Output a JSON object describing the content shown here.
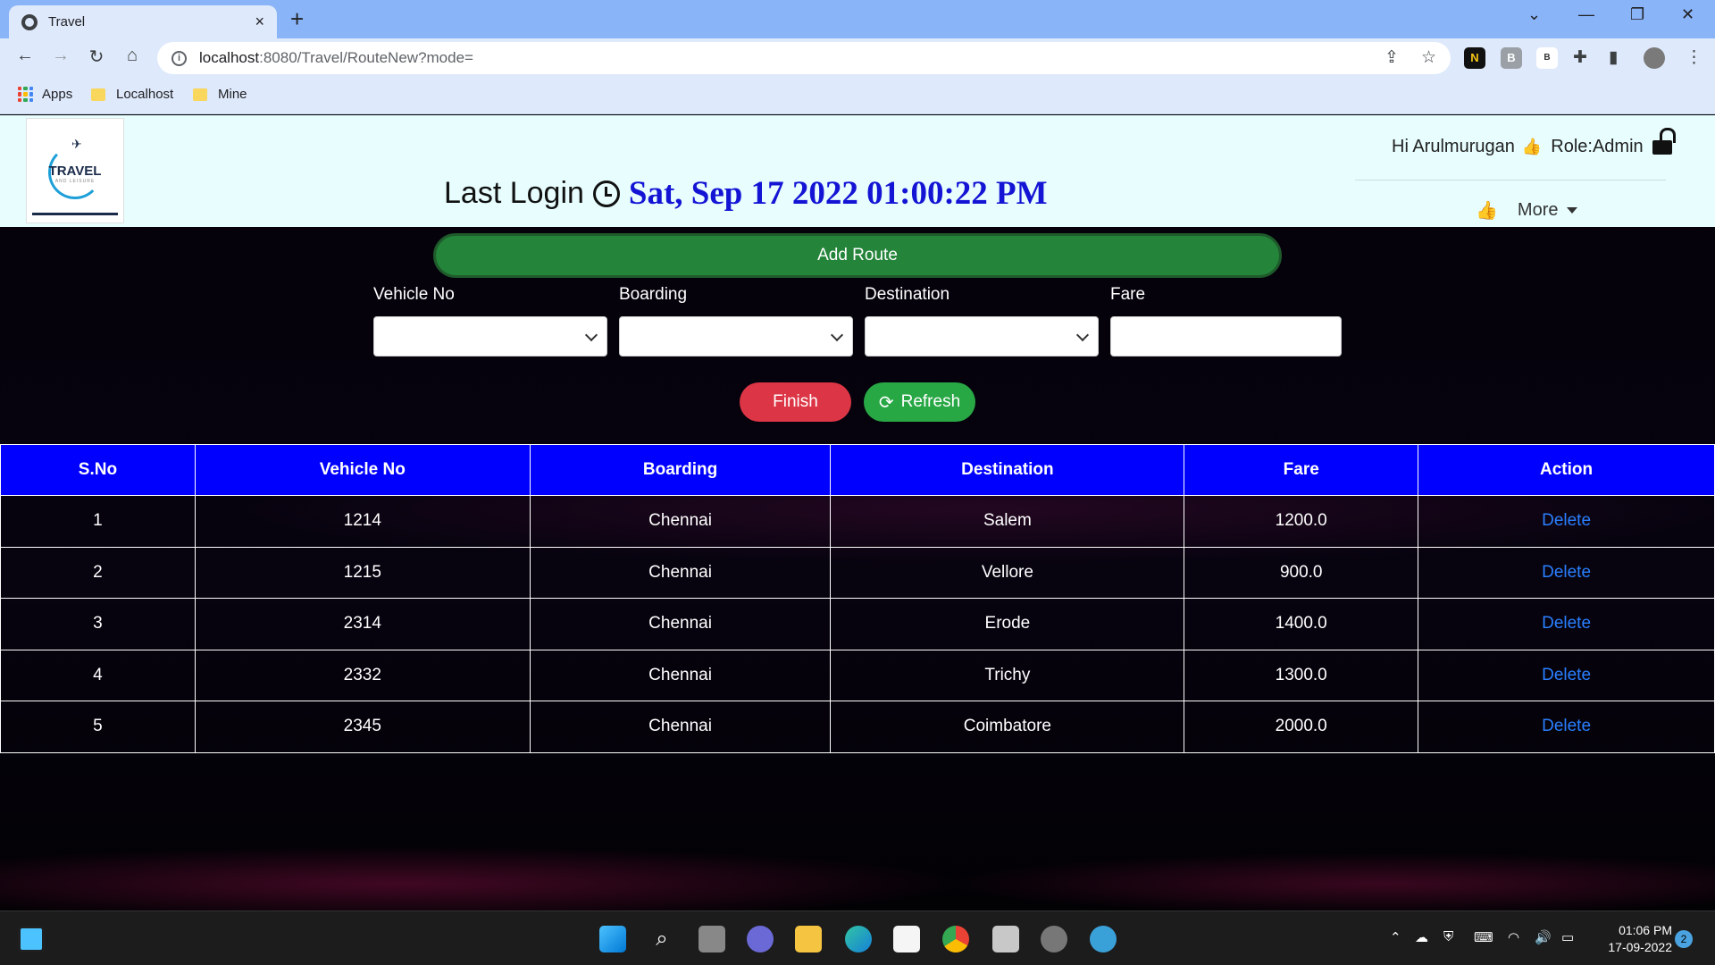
{
  "browser": {
    "tab_title": "Travel",
    "tab_close": "×",
    "new_tab": "+",
    "url_host": "localhost",
    "url_path": ":8080/Travel/RouteNew?mode=",
    "bookmarks": [
      {
        "label": "Apps",
        "icon": "apps-grid-icon"
      },
      {
        "label": "Localhost",
        "icon": "folder-icon"
      },
      {
        "label": "Mine",
        "icon": "folder-icon"
      }
    ],
    "extensions": [
      "N",
      "B",
      "B"
    ]
  },
  "header": {
    "last_login_label": "Last Login",
    "last_login_value": "Sat, Sep 17 2022 01:00:22 PM",
    "greeting": "Hi Arulmurugan",
    "role": "Role:Admin",
    "more_label": "More",
    "logo_text": "TRAVEL",
    "logo_sub": "AND LEISURE"
  },
  "toolbar": {
    "add_route_label": "Add Route"
  },
  "form": {
    "vehicle_label": "Vehicle No",
    "boarding_label": "Boarding",
    "destination_label": "Destination",
    "fare_label": "Fare",
    "vehicle_value": "",
    "boarding_value": "",
    "destination_value": "",
    "fare_value": ""
  },
  "actions": {
    "finish_label": "Finish",
    "refresh_label": "Refresh"
  },
  "table": {
    "headers": [
      "S.No",
      "Vehicle No",
      "Boarding",
      "Destination",
      "Fare",
      "Action"
    ],
    "rows": [
      {
        "sno": "1",
        "vehicle": "1214",
        "boarding": "Chennai",
        "destination": "Salem",
        "fare": "1200.0",
        "action": "Delete"
      },
      {
        "sno": "2",
        "vehicle": "1215",
        "boarding": "Chennai",
        "destination": "Vellore",
        "fare": "900.0",
        "action": "Delete"
      },
      {
        "sno": "3",
        "vehicle": "2314",
        "boarding": "Chennai",
        "destination": "Erode",
        "fare": "1400.0",
        "action": "Delete"
      },
      {
        "sno": "4",
        "vehicle": "2332",
        "boarding": "Chennai",
        "destination": "Trichy",
        "fare": "1300.0",
        "action": "Delete"
      },
      {
        "sno": "5",
        "vehicle": "2345",
        "boarding": "Chennai",
        "destination": "Coimbatore",
        "fare": "2000.0",
        "action": "Delete"
      }
    ]
  },
  "taskbar": {
    "time": "01:06 PM",
    "date": "17-09-2022",
    "notifications": "2"
  },
  "colors": {
    "header_bg": "#e7fdfe",
    "add_route_green": "#23843a",
    "table_header_blue": "#0000ff",
    "finish_red": "#dc3545",
    "refresh_green": "#28a745",
    "last_login_date": "#1414d4",
    "delete_link": "#2a7fff"
  }
}
